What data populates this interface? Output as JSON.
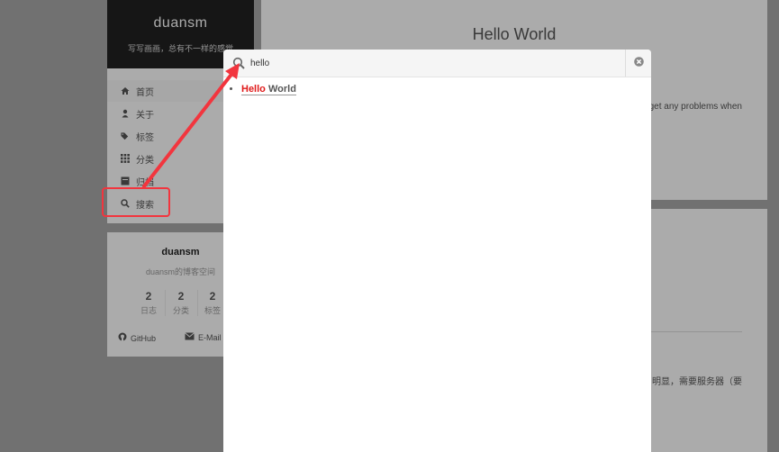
{
  "brand": {
    "title": "duansm",
    "subtitle": "写写画画，总有不一样的感觉"
  },
  "menu": {
    "items": [
      {
        "label": "首页",
        "icon": "home-icon"
      },
      {
        "label": "关于",
        "icon": "user-icon"
      },
      {
        "label": "标签",
        "icon": "tags-icon"
      },
      {
        "label": "分类",
        "icon": "grid-icon"
      },
      {
        "label": "归档",
        "icon": "archive-icon"
      },
      {
        "label": "搜索",
        "icon": "search-icon"
      }
    ]
  },
  "profile": {
    "author": "duansm",
    "description": "duansm的博客空间",
    "stats": [
      {
        "count": "2",
        "label": "日志"
      },
      {
        "count": "2",
        "label": "分类"
      },
      {
        "count": "2",
        "label": "标签"
      }
    ],
    "links": [
      {
        "label": "GitHub",
        "icon": "github-icon"
      },
      {
        "label": "E-Mail",
        "icon": "envelope-icon"
      }
    ]
  },
  "post": {
    "title": "Hello World",
    "excerpt": "get any problems when"
  },
  "post2": {
    "excerpt": "明显，需要服务器（要"
  },
  "search": {
    "query": "hello",
    "results": [
      {
        "highlight": "Hello",
        "rest": " World"
      }
    ]
  },
  "colors": {
    "accent_red": "#f2353e",
    "highlight_text": "#e01b1b",
    "brand_bg": "#222222"
  }
}
